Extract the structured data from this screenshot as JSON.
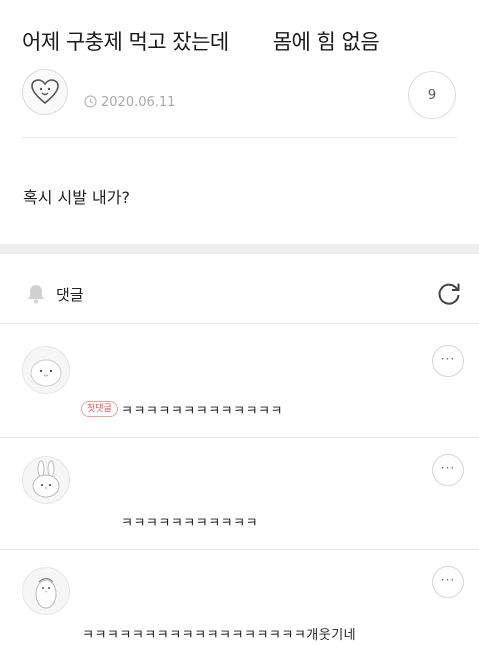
{
  "post": {
    "title_part1": "어제 구충제 먹고 잤는데",
    "title_part2": "몸에 힘 없음",
    "date": "2020.06.11",
    "comment_count": "9",
    "body": "혹시 시발 내가?"
  },
  "comments_section": {
    "label": "댓글"
  },
  "comments": [
    {
      "badge": "첫댓글",
      "text": "ㅋㅋㅋㅋㅋㅋㅋㅋㅋㅋㅋㅋㅋ",
      "more": "···"
    },
    {
      "text": "ㅋㅋㅋㅋㅋㅋㅋㅋㅋㅋㅋ",
      "more": "···"
    },
    {
      "text": "ㅋㅋㅋㅋㅋㅋㅋㅋㅋㅋㅋㅋㅋㅋㅋㅋㅋㅋ개웃기네",
      "more": "···"
    }
  ],
  "colors": {
    "background": "#ffffff",
    "divider": "#e8e8e8",
    "section_gap": "#ededed",
    "badge_red": "#e25a4a",
    "meta_text": "#aaaaaa"
  },
  "icons": [
    "heart-face-icon",
    "clock-icon",
    "bell-icon",
    "refresh-icon",
    "more-icon"
  ]
}
